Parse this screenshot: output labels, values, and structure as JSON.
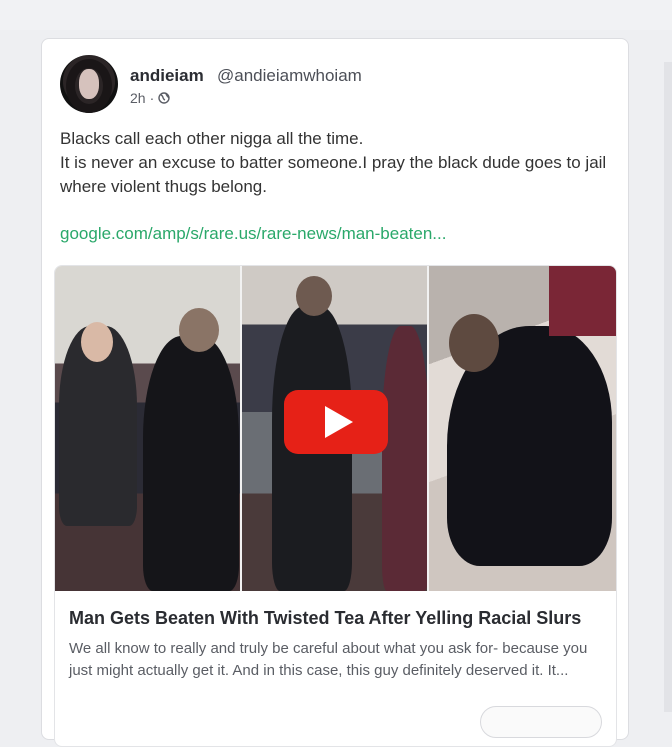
{
  "post": {
    "author_name": "andieiam",
    "author_handle": "@andieiamwhoiam",
    "time": "2h",
    "separator": "·",
    "lines": [
      "Blacks call each other nigga all the time.",
      "It is never an excuse to batter someone.I pray the black dude goes to jail where violent thugs belong."
    ],
    "link": "google.com/amp/s/rare.us/rare-news/man-beaten..."
  },
  "preview": {
    "title": "Man Gets Beaten With Twisted Tea After Yelling Racial Slurs",
    "description": "We all know to really and truly be careful about what you ask for- because you just might actually get it. And in this case, this guy definitely deserved it. It..."
  },
  "colors": {
    "link": "#2aa86a",
    "play_button": "#e62117"
  },
  "icons": {
    "visibility": "globe-icon",
    "play": "play-icon"
  }
}
